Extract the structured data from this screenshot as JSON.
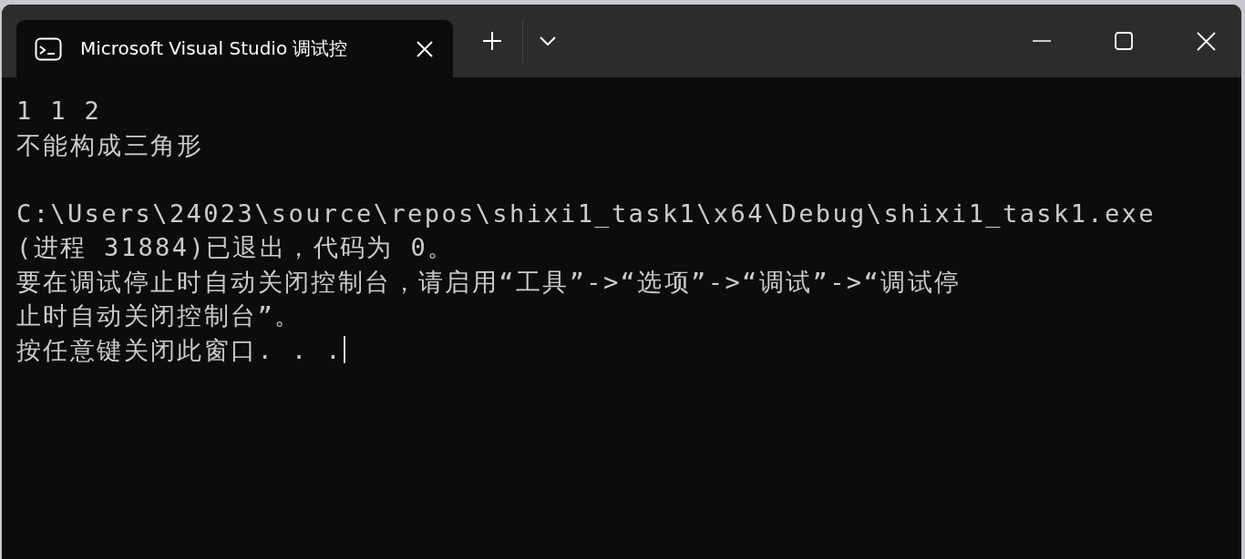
{
  "tab": {
    "title": "Microsoft Visual Studio 调试控",
    "selected": true
  },
  "output_lines": [
    "1 1 2",
    "不能构成三角形"
  ],
  "exit_lines": [
    "C:\\Users\\24023\\source\\repos\\shixi1_task1\\x64\\Debug\\shixi1_task1.exe",
    "(进程 31884)已退出，代码为 0。",
    "要在调试停止时自动关闭控制台，请启用“工具”->“选项”->“调试”->“调试停",
    "止时自动关闭控制台”。",
    "按任意键关闭此窗口. . ."
  ]
}
